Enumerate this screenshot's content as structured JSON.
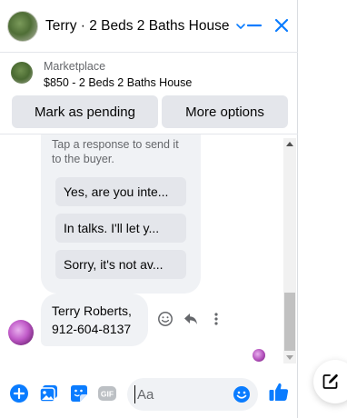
{
  "header": {
    "title": "Terry · 2 Beds 2 Baths House",
    "avatar_icon": "listing-photo",
    "chevron_icon": "chevron-down-icon",
    "minimize_icon": "minimize-icon",
    "close_icon": "close-icon",
    "accent": "#0a7cff"
  },
  "marketplace": {
    "label": "Marketplace",
    "item": "$850 - 2 Beds 2 Baths House",
    "mark_pending_label": "Mark as pending",
    "more_options_label": "More options"
  },
  "conversation": {
    "prompt": "Tap a response to send it to the buyer.",
    "quick_replies": [
      "Yes, are you inte...",
      "In talks. I'll let y...",
      "Sorry, it's not av..."
    ],
    "message_lines": [
      "Terry Roberts,",
      "912-604-8137"
    ],
    "actions": [
      "emoji-react-icon",
      "reply-icon",
      "more-vertical-icon"
    ]
  },
  "composer": {
    "placeholder": "Aa",
    "icons": [
      "plus-circle-icon",
      "photo-icon",
      "sticker-icon",
      "gif-icon",
      "emoji-icon",
      "thumbs-up-icon"
    ]
  },
  "fab_icon": "new-message-icon"
}
